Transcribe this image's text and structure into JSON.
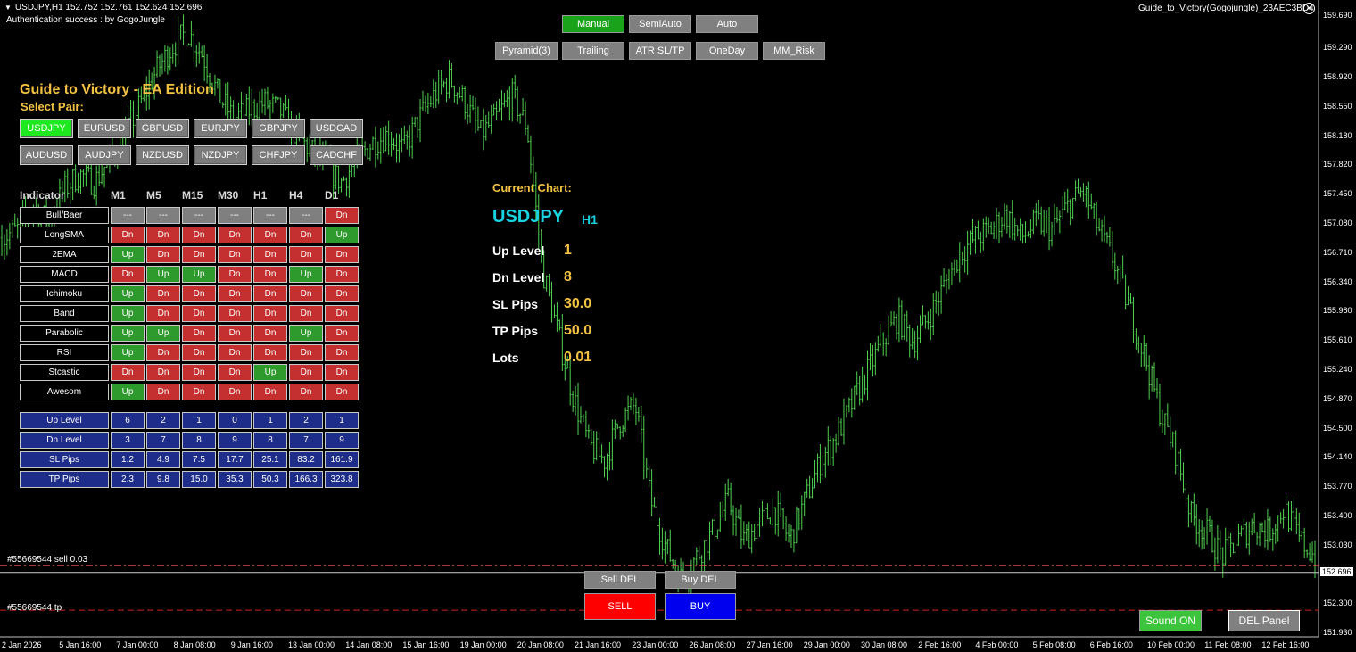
{
  "header": {
    "symbol_line": "USDJPY,H1  152.752 152.761 152.624 152.696",
    "auth": "Authentication success : by GogoJungle",
    "ea_name": "Guide_to_Victory(Gogojungle)_23AEC3BD4"
  },
  "mode_buttons": [
    "Manual",
    "SemiAuto",
    "Auto"
  ],
  "option_buttons": [
    "Pyramid(3)",
    "Trailing",
    "ATR SL/TP",
    "OneDay",
    "MM_Risk"
  ],
  "panel": {
    "title": "Guide to Victory - EA Edition",
    "select_pair": "Select Pair:",
    "pairs_row1": [
      "USDJPY",
      "EURUSD",
      "GBPUSD",
      "EURJPY",
      "GBPJPY",
      "USDCAD"
    ],
    "pairs_row2": [
      "AUDUSD",
      "AUDJPY",
      "NZDUSD",
      "NZDJPY",
      "CHFJPY",
      "CADCHF"
    ]
  },
  "table": {
    "header_indicator": "Indicator",
    "timeframes": [
      "M1",
      "M5",
      "M15",
      "M30",
      "H1",
      "H4",
      "D1"
    ],
    "rows": [
      {
        "name": "Bull/Baer",
        "signals": [
          "---",
          "---",
          "---",
          "---",
          "---",
          "---",
          "Dn"
        ]
      },
      {
        "name": "LongSMA",
        "signals": [
          "Dn",
          "Dn",
          "Dn",
          "Dn",
          "Dn",
          "Dn",
          "Up"
        ]
      },
      {
        "name": "2EMA",
        "signals": [
          "Up",
          "Dn",
          "Dn",
          "Dn",
          "Dn",
          "Dn",
          "Dn"
        ]
      },
      {
        "name": "MACD",
        "signals": [
          "Dn",
          "Up",
          "Up",
          "Dn",
          "Dn",
          "Up",
          "Dn"
        ]
      },
      {
        "name": "Ichimoku",
        "signals": [
          "Up",
          "Dn",
          "Dn",
          "Dn",
          "Dn",
          "Dn",
          "Dn"
        ]
      },
      {
        "name": "Band",
        "signals": [
          "Up",
          "Dn",
          "Dn",
          "Dn",
          "Dn",
          "Dn",
          "Dn"
        ]
      },
      {
        "name": "Parabolic",
        "signals": [
          "Up",
          "Up",
          "Dn",
          "Dn",
          "Dn",
          "Up",
          "Dn"
        ]
      },
      {
        "name": "RSI",
        "signals": [
          "Up",
          "Dn",
          "Dn",
          "Dn",
          "Dn",
          "Dn",
          "Dn"
        ]
      },
      {
        "name": "Stcastic",
        "signals": [
          "Dn",
          "Dn",
          "Dn",
          "Dn",
          "Up",
          "Dn",
          "Dn"
        ]
      },
      {
        "name": "Awesom",
        "signals": [
          "Up",
          "Dn",
          "Dn",
          "Dn",
          "Dn",
          "Dn",
          "Dn"
        ]
      }
    ],
    "summary": [
      {
        "name": "Up Level",
        "values": [
          "6",
          "2",
          "1",
          "0",
          "1",
          "2",
          "1"
        ]
      },
      {
        "name": "Dn Level",
        "values": [
          "3",
          "7",
          "8",
          "9",
          "8",
          "7",
          "9"
        ]
      },
      {
        "name": "SL Pips",
        "values": [
          "1.2",
          "4.9",
          "7.5",
          "17.7",
          "25.1",
          "83.2",
          "161.9"
        ]
      },
      {
        "name": "TP Pips",
        "values": [
          "2.3",
          "9.8",
          "15.0",
          "35.3",
          "50.3",
          "166.3",
          "323.8"
        ]
      }
    ]
  },
  "current_chart": {
    "title": "Current Chart:",
    "symbol": "USDJPY",
    "timeframe": "H1",
    "items": [
      {
        "label": "Up Level",
        "value": "1"
      },
      {
        "label": "Dn Level",
        "value": "8"
      },
      {
        "label": "SL Pips",
        "value": "30.0"
      },
      {
        "label": "TP Pips",
        "value": "50.0"
      },
      {
        "label": "Lots",
        "value": "0.01"
      }
    ]
  },
  "trade_buttons": {
    "sell_del": "Sell DEL",
    "buy_del": "Buy DEL",
    "sell": "SELL",
    "buy": "BUY",
    "sound": "Sound ON",
    "del_panel": "DEL Panel"
  },
  "order_lines": {
    "sell_label": "#55669544 sell 0.03",
    "tp_label": "#55669544 tp",
    "sell_price": 152.78,
    "tp_price": 152.22,
    "current_price": 152.696
  },
  "price_axis": [
    "159.690",
    "159.290",
    "158.920",
    "158.550",
    "158.180",
    "157.820",
    "157.450",
    "157.080",
    "156.710",
    "156.340",
    "155.980",
    "155.610",
    "155.240",
    "154.870",
    "154.500",
    "154.140",
    "153.770",
    "153.400",
    "153.030",
    "152.696",
    "152.300",
    "151.930"
  ],
  "date_axis": [
    "2 Jan 2026",
    "5 Jan 16:00",
    "7 Jan 00:00",
    "8 Jan 08:00",
    "9 Jan 16:00",
    "13 Jan 00:00",
    "14 Jan 08:00",
    "15 Jan 16:00",
    "19 Jan 00:00",
    "20 Jan 08:00",
    "21 Jan 16:00",
    "23 Jan 00:00",
    "26 Jan 08:00",
    "27 Jan 16:00",
    "29 Jan 00:00",
    "30 Jan 08:00",
    "2 Feb 16:00",
    "4 Feb 00:00",
    "5 Feb 08:00",
    "6 Feb 16:00",
    "10 Feb 00:00",
    "11 Feb 08:00",
    "12 Feb 16:00"
  ],
  "chart_data": {
    "type": "line",
    "series": [
      {
        "name": "USDJPY,H1",
        "values": [
          156.9,
          157.0,
          157.3,
          157.1,
          157.5,
          157.7,
          157.6,
          157.9,
          158.2,
          158.6,
          159.0,
          159.3,
          159.5,
          159.2,
          158.7,
          158.4,
          158.5,
          158.6,
          158.5,
          158.2,
          158.0,
          157.8,
          157.6,
          157.9,
          158.1,
          158.2,
          158.0,
          158.4,
          158.7,
          158.9,
          158.6,
          158.2,
          158.4,
          158.7,
          158.3,
          156.5,
          155.7,
          154.9,
          154.3,
          154.1,
          154.6,
          154.8,
          153.6,
          153.0,
          152.6,
          152.9,
          153.2,
          153.6,
          153.1,
          153.3,
          153.5,
          153.1,
          153.6,
          154.1,
          154.4,
          154.8,
          155.2,
          155.6,
          155.9,
          155.6,
          155.9,
          156.3,
          156.7,
          156.9,
          157.0,
          157.2,
          156.9,
          157.1,
          157.0,
          157.3,
          157.5,
          157.0,
          156.6,
          156.0,
          155.4,
          154.7,
          154.2,
          153.4,
          153.2,
          152.9,
          153.1,
          153.3,
          153.2,
          153.5,
          153.1,
          152.9
        ]
      }
    ],
    "ylim": [
      151.93,
      159.69
    ]
  },
  "colors": {
    "candles": "#4fd14f",
    "sell_line": "#e05050",
    "tp_line": "#d02020",
    "price_line": "#cccccc",
    "panel_title": "#f3c242",
    "current_symbol": "#19d3e0"
  }
}
